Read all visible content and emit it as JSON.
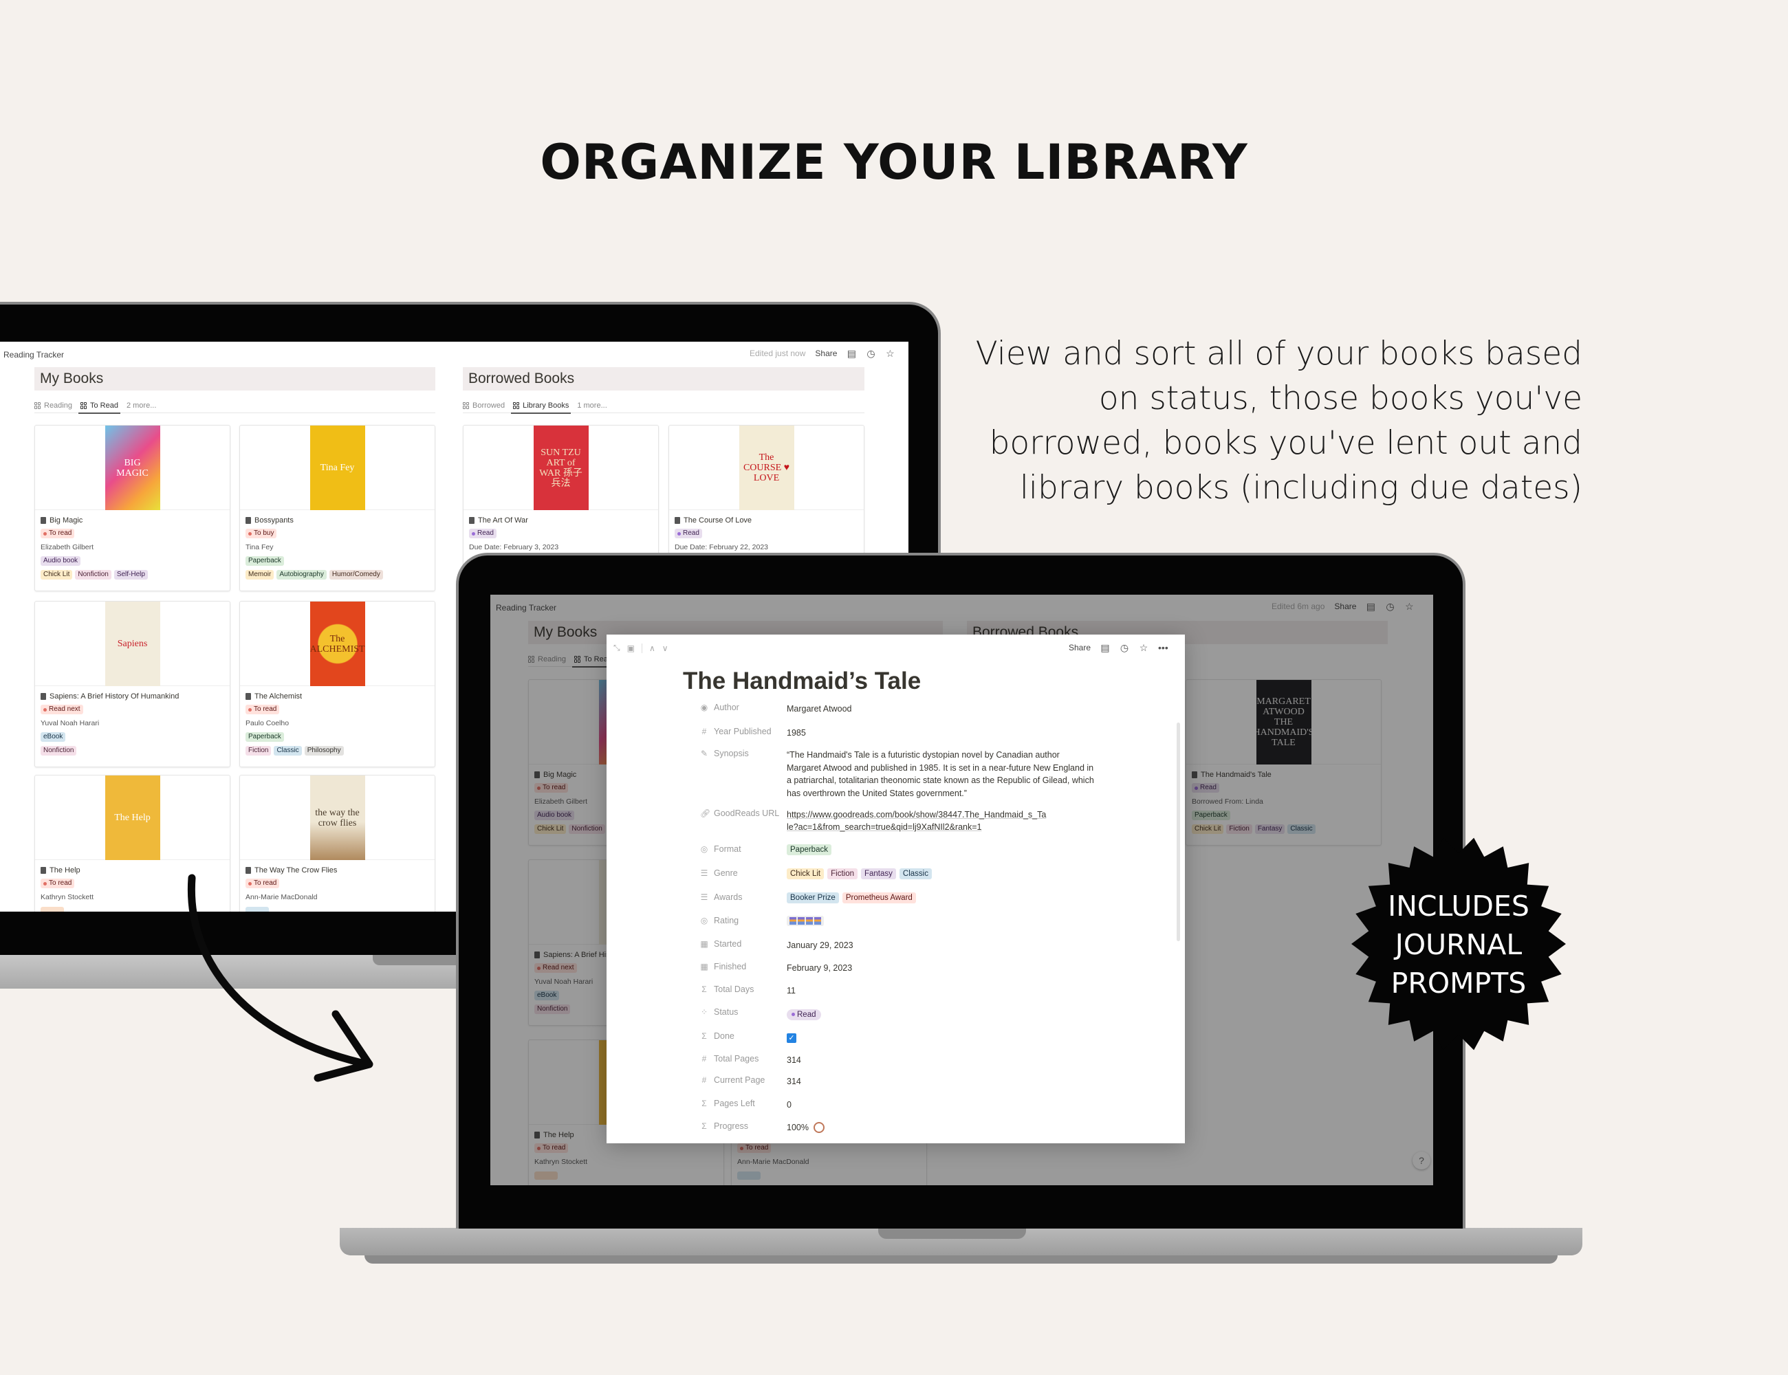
{
  "headline": "ORGANIZE YOUR LIBRARY",
  "description": [
    "View and sort all of your books based",
    "on status, those books you've",
    "borrowed, books you've lent out and",
    "library books (including due dates)"
  ],
  "badge": [
    "INCLUDES",
    "JOURNAL",
    "PROMPTS"
  ],
  "colors": {
    "page_bg": "#f5f1ed",
    "bezel": "#050505",
    "db_header_bg": "#f1ecec",
    "checkbox": "#2383e2",
    "progress_ring": "#c0785a"
  },
  "tag_colors": {
    "red": {
      "bg": "#ffe2dd",
      "fg": "#5d1715",
      "dot": "#e16f64"
    },
    "purple": {
      "bg": "#e8deee",
      "fg": "#412454",
      "dot": "#9a6dd7"
    },
    "green": {
      "bg": "#dbeddb",
      "fg": "#1c3829"
    },
    "blue": {
      "bg": "#d3e5ef",
      "fg": "#183347"
    },
    "yellow": {
      "bg": "#fdecc8",
      "fg": "#402c1b"
    },
    "pink": {
      "bg": "#f5e0e9",
      "fg": "#4c2337"
    },
    "orange": {
      "bg": "#fadec9",
      "fg": "#49290e"
    },
    "brown": {
      "bg": "#eee0da",
      "fg": "#442a1e"
    },
    "gray": {
      "bg": "#e3e2e0",
      "fg": "#32302c"
    }
  },
  "left_screen": {
    "breadcrumb": "Reading Tracker",
    "edited": "Edited just now",
    "share": "Share",
    "my_books": {
      "title": "My Books",
      "tabs": [
        "Reading",
        "To Read"
      ],
      "active_tab": 1,
      "more": "2 more..."
    },
    "borrowed": {
      "title": "Borrowed Books",
      "tabs": [
        "Borrowed",
        "Library Books"
      ],
      "active_tab": 1,
      "more": "1 more...",
      "cards": [
        {
          "title": "The Art Of War",
          "status": {
            "label": "Read",
            "color": "purple"
          },
          "due": "Due Date: February 3, 2023",
          "cover": {
            "bg": "#d8323b",
            "fg": "#f3e3c0",
            "text": "SUN TZU ART of WAR 孫子兵法"
          }
        },
        {
          "title": "The Course Of Love",
          "status": {
            "label": "Read",
            "color": "purple"
          },
          "due": "Due Date: February 22, 2023",
          "cover": {
            "bg": "#f3ecd6",
            "fg": "#c4161c",
            "text": "The COURSE ♥ LOVE"
          }
        }
      ]
    }
  },
  "books": [
    {
      "title": "Big Magic",
      "status": {
        "label": "To read",
        "color": "red"
      },
      "author": "Elizabeth Gilbert",
      "format": {
        "label": "Audio book",
        "color": "purple"
      },
      "genres": [
        {
          "label": "Chick Lit",
          "color": "yellow"
        },
        {
          "label": "Nonfiction",
          "color": "pink"
        },
        {
          "label": "Self-Help",
          "color": "purple"
        }
      ],
      "cover": {
        "bg": "linear-gradient(135deg,#6fc3e8,#e94d8a 45%,#f7a53b 75%,#e8e13a)",
        "fg": "#fff",
        "text": "BIG MAGIC"
      }
    },
    {
      "title": "Bossypants",
      "status": {
        "label": "To buy",
        "color": "red"
      },
      "author": "Tina Fey",
      "format": {
        "label": "Paperback",
        "color": "green"
      },
      "genres": [
        {
          "label": "Memoir",
          "color": "yellow"
        },
        {
          "label": "Autobiography",
          "color": "green"
        },
        {
          "label": "Humor/Comedy",
          "color": "brown"
        }
      ],
      "cover": {
        "bg": "#f0be16",
        "fg": "#fff",
        "text": "Tina Fey"
      }
    },
    {
      "title": "Sapiens: A Brief History Of Humankind",
      "status": {
        "label": "Read next",
        "color": "red"
      },
      "author": "Yuval Noah Harari",
      "format": {
        "label": "eBook",
        "color": "blue"
      },
      "genres": [
        {
          "label": "Nonfiction",
          "color": "pink"
        }
      ],
      "cover": {
        "bg": "#f2ecdc",
        "fg": "#c8232c",
        "text": "Sapiens"
      }
    },
    {
      "title": "The Alchemist",
      "status": {
        "label": "To read",
        "color": "red"
      },
      "author": "Paulo Coelho",
      "format": {
        "label": "Paperback",
        "color": "green"
      },
      "genres": [
        {
          "label": "Fiction",
          "color": "pink"
        },
        {
          "label": "Classic",
          "color": "blue"
        },
        {
          "label": "Philosophy",
          "color": "gray"
        }
      ],
      "cover": {
        "bg": "radial-gradient(circle,#f4c12d 38%,#e2461d 40%)",
        "fg": "#7a2b0b",
        "text": "The ALCHEMIST"
      }
    },
    {
      "title": "The Help",
      "status": {
        "label": "To read",
        "color": "red"
      },
      "author": "Kathryn Stockett",
      "format": {
        "label": "",
        "color": "orange"
      },
      "genres": [],
      "cover": {
        "bg": "#efb93a",
        "fg": "#fff",
        "text": "The Help"
      }
    },
    {
      "title": "The Way The Crow Flies",
      "status": {
        "label": "To read",
        "color": "red"
      },
      "author": "Ann-Marie MacDonald",
      "format": {
        "label": "",
        "color": "blue"
      },
      "genres": [],
      "cover": {
        "bg": "linear-gradient(#efe7d4 55%,#b08a5e)",
        "fg": "#4a3b2a",
        "text": "the way the crow flies"
      }
    }
  ],
  "right_screen": {
    "breadcrumb": "Reading Tracker",
    "edited": "Edited 6m ago",
    "share": "Share",
    "my_books": {
      "title": "My Books",
      "tabs": [
        "Reading",
        "To Read"
      ]
    },
    "borrowed": {
      "title": "Borrowed Books",
      "card": {
        "title": "The Handmaid's Tale",
        "borrowed_from": "Borrowed From: Linda",
        "status": {
          "label": "Read",
          "color": "purple"
        },
        "format": {
          "label": "Paperback",
          "color": "green"
        },
        "genres": [
          {
            "label": "Chick Lit",
            "color": "yellow"
          },
          {
            "label": "Fiction",
            "color": "pink"
          },
          {
            "label": "Fantasy",
            "color": "purple"
          },
          {
            "label": "Classic",
            "color": "blue"
          }
        ],
        "cover": {
          "bg": "#1d1d1f",
          "fg": "#e8e8e8",
          "text": "MARGARET ATWOOD THE HANDMAID'S TALE"
        }
      }
    },
    "help": "?"
  },
  "modal": {
    "share": "Share",
    "title": "The Handmaid’s Tale",
    "properties": [
      {
        "icon": "person",
        "label": "Author",
        "value": "Margaret Atwood"
      },
      {
        "icon": "hash",
        "label": "Year Published",
        "value": "1985"
      },
      {
        "icon": "edit",
        "label": "Synopsis",
        "value": "“The Handmaid's Tale is a futuristic dystopian novel by Canadian author Margaret Atwood and published in 1985. It is set in a near-future New England in a patriarchal, totalitarian theonomic state known as the Republic of Gilead, which has overthrown the United States government.”"
      },
      {
        "icon": "link",
        "label": "GoodReads URL",
        "value": "https://www.goodreads.com/book/show/38447.The_Handmaid_s_Tale?ac=1&from_search=true&qid=lj9XafNIl2&rank=1"
      },
      {
        "icon": "select",
        "label": "Format",
        "tags": [
          {
            "label": "Paperback",
            "color": "green"
          }
        ]
      },
      {
        "icon": "list",
        "label": "Genre",
        "tags": [
          {
            "label": "Chick Lit",
            "color": "yellow"
          },
          {
            "label": "Fiction",
            "color": "pink"
          },
          {
            "label": "Fantasy",
            "color": "purple"
          },
          {
            "label": "Classic",
            "color": "blue"
          }
        ]
      },
      {
        "icon": "list",
        "label": "Awards",
        "tags": [
          {
            "label": "Booker Prize",
            "color": "blue"
          },
          {
            "label": "Prometheus Award",
            "color": "red"
          }
        ]
      },
      {
        "icon": "select",
        "label": "Rating",
        "rating": 4
      },
      {
        "icon": "calendar",
        "label": "Started",
        "value": "January 29, 2023"
      },
      {
        "icon": "calendar",
        "label": "Finished",
        "value": "February 9, 2023"
      },
      {
        "icon": "sigma",
        "label": "Total Days",
        "value": "11"
      },
      {
        "icon": "status",
        "label": "Status",
        "status": {
          "label": "Read",
          "color": "purple"
        }
      },
      {
        "icon": "sigma",
        "label": "Done",
        "checked": true
      },
      {
        "icon": "hash",
        "label": "Total Pages",
        "value": "314"
      },
      {
        "icon": "hash",
        "label": "Current Page",
        "value": "314"
      },
      {
        "icon": "sigma",
        "label": "Pages Left",
        "value": "0"
      },
      {
        "icon": "sigma",
        "label": "Progress",
        "value": "100%",
        "progress": 1.0
      }
    ]
  }
}
